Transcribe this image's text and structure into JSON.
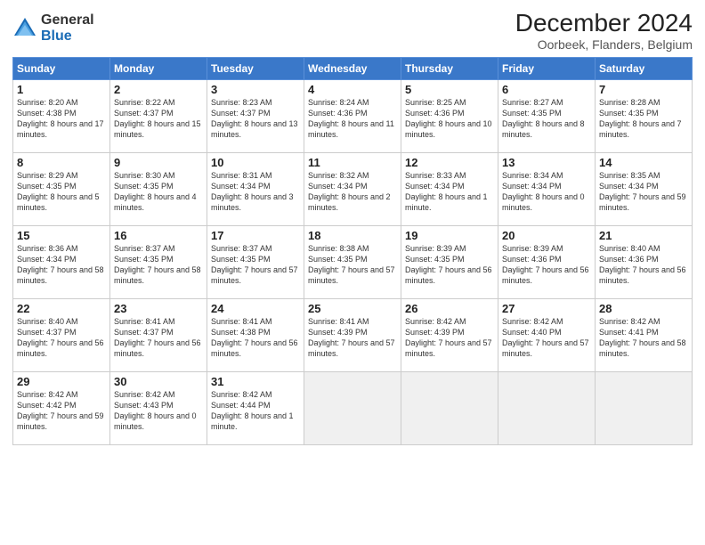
{
  "logo": {
    "general": "General",
    "blue": "Blue"
  },
  "header": {
    "title": "December 2024",
    "subtitle": "Oorbeek, Flanders, Belgium"
  },
  "weekdays": [
    "Sunday",
    "Monday",
    "Tuesday",
    "Wednesday",
    "Thursday",
    "Friday",
    "Saturday"
  ],
  "weeks": [
    [
      {
        "day": "1",
        "sunrise": "8:20 AM",
        "sunset": "4:38 PM",
        "daylight": "8 hours and 17 minutes."
      },
      {
        "day": "2",
        "sunrise": "8:22 AM",
        "sunset": "4:37 PM",
        "daylight": "8 hours and 15 minutes."
      },
      {
        "day": "3",
        "sunrise": "8:23 AM",
        "sunset": "4:37 PM",
        "daylight": "8 hours and 13 minutes."
      },
      {
        "day": "4",
        "sunrise": "8:24 AM",
        "sunset": "4:36 PM",
        "daylight": "8 hours and 11 minutes."
      },
      {
        "day": "5",
        "sunrise": "8:25 AM",
        "sunset": "4:36 PM",
        "daylight": "8 hours and 10 minutes."
      },
      {
        "day": "6",
        "sunrise": "8:27 AM",
        "sunset": "4:35 PM",
        "daylight": "8 hours and 8 minutes."
      },
      {
        "day": "7",
        "sunrise": "8:28 AM",
        "sunset": "4:35 PM",
        "daylight": "8 hours and 7 minutes."
      }
    ],
    [
      {
        "day": "8",
        "sunrise": "8:29 AM",
        "sunset": "4:35 PM",
        "daylight": "8 hours and 5 minutes."
      },
      {
        "day": "9",
        "sunrise": "8:30 AM",
        "sunset": "4:35 PM",
        "daylight": "8 hours and 4 minutes."
      },
      {
        "day": "10",
        "sunrise": "8:31 AM",
        "sunset": "4:34 PM",
        "daylight": "8 hours and 3 minutes."
      },
      {
        "day": "11",
        "sunrise": "8:32 AM",
        "sunset": "4:34 PM",
        "daylight": "8 hours and 2 minutes."
      },
      {
        "day": "12",
        "sunrise": "8:33 AM",
        "sunset": "4:34 PM",
        "daylight": "8 hours and 1 minute."
      },
      {
        "day": "13",
        "sunrise": "8:34 AM",
        "sunset": "4:34 PM",
        "daylight": "8 hours and 0 minutes."
      },
      {
        "day": "14",
        "sunrise": "8:35 AM",
        "sunset": "4:34 PM",
        "daylight": "7 hours and 59 minutes."
      }
    ],
    [
      {
        "day": "15",
        "sunrise": "8:36 AM",
        "sunset": "4:34 PM",
        "daylight": "7 hours and 58 minutes."
      },
      {
        "day": "16",
        "sunrise": "8:37 AM",
        "sunset": "4:35 PM",
        "daylight": "7 hours and 58 minutes."
      },
      {
        "day": "17",
        "sunrise": "8:37 AM",
        "sunset": "4:35 PM",
        "daylight": "7 hours and 57 minutes."
      },
      {
        "day": "18",
        "sunrise": "8:38 AM",
        "sunset": "4:35 PM",
        "daylight": "7 hours and 57 minutes."
      },
      {
        "day": "19",
        "sunrise": "8:39 AM",
        "sunset": "4:35 PM",
        "daylight": "7 hours and 56 minutes."
      },
      {
        "day": "20",
        "sunrise": "8:39 AM",
        "sunset": "4:36 PM",
        "daylight": "7 hours and 56 minutes."
      },
      {
        "day": "21",
        "sunrise": "8:40 AM",
        "sunset": "4:36 PM",
        "daylight": "7 hours and 56 minutes."
      }
    ],
    [
      {
        "day": "22",
        "sunrise": "8:40 AM",
        "sunset": "4:37 PM",
        "daylight": "7 hours and 56 minutes."
      },
      {
        "day": "23",
        "sunrise": "8:41 AM",
        "sunset": "4:37 PM",
        "daylight": "7 hours and 56 minutes."
      },
      {
        "day": "24",
        "sunrise": "8:41 AM",
        "sunset": "4:38 PM",
        "daylight": "7 hours and 56 minutes."
      },
      {
        "day": "25",
        "sunrise": "8:41 AM",
        "sunset": "4:39 PM",
        "daylight": "7 hours and 57 minutes."
      },
      {
        "day": "26",
        "sunrise": "8:42 AM",
        "sunset": "4:39 PM",
        "daylight": "7 hours and 57 minutes."
      },
      {
        "day": "27",
        "sunrise": "8:42 AM",
        "sunset": "4:40 PM",
        "daylight": "7 hours and 57 minutes."
      },
      {
        "day": "28",
        "sunrise": "8:42 AM",
        "sunset": "4:41 PM",
        "daylight": "7 hours and 58 minutes."
      }
    ],
    [
      {
        "day": "29",
        "sunrise": "8:42 AM",
        "sunset": "4:42 PM",
        "daylight": "7 hours and 59 minutes."
      },
      {
        "day": "30",
        "sunrise": "8:42 AM",
        "sunset": "4:43 PM",
        "daylight": "8 hours and 0 minutes."
      },
      {
        "day": "31",
        "sunrise": "8:42 AM",
        "sunset": "4:44 PM",
        "daylight": "8 hours and 1 minute."
      },
      null,
      null,
      null,
      null
    ]
  ]
}
